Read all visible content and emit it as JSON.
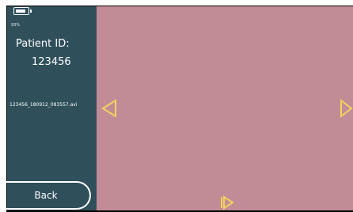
{
  "status": {
    "battery_percent": "93%"
  },
  "patient": {
    "id_label": "Patient ID:",
    "id_value": "123456"
  },
  "file": {
    "name": "123456_180912_083557.avi"
  },
  "controls": {
    "back_label": "Back"
  },
  "icons": {
    "battery": "battery-icon",
    "previous": "chevron-left-icon",
    "next": "chevron-right-icon",
    "play": "play-step-icon"
  },
  "colors": {
    "sidebar": "#2f4f5b",
    "video_background": "#c28c96",
    "accent": "#f3d35e",
    "text": "#ffffff"
  }
}
